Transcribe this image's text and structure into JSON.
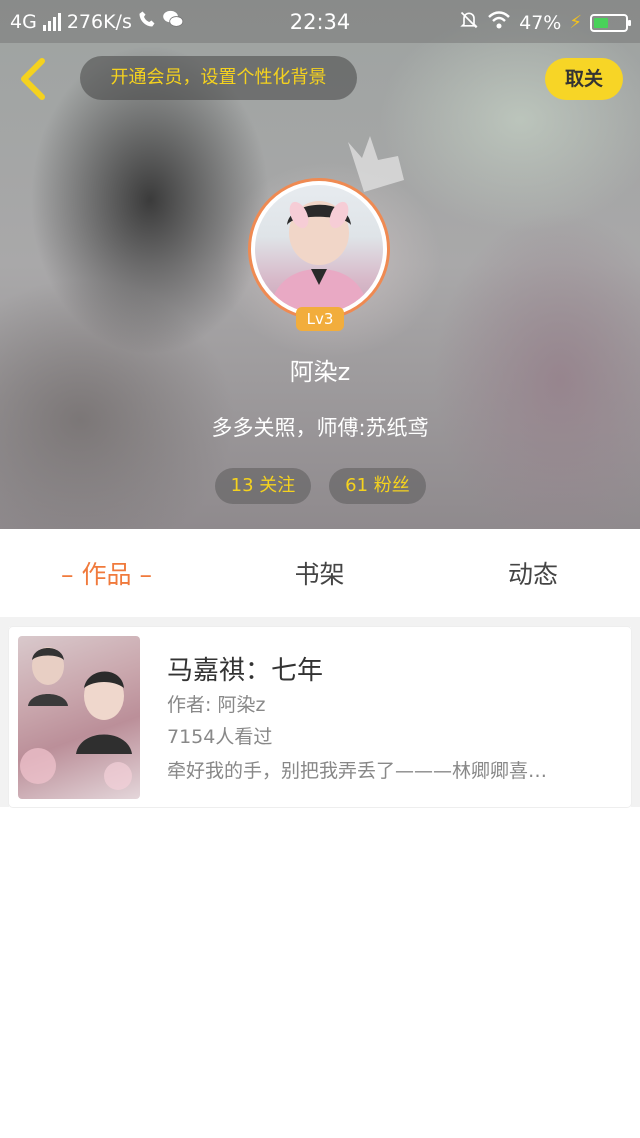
{
  "status_bar": {
    "network": "4G",
    "speed": "276K/s",
    "time": "22:34",
    "battery": "47%",
    "battery_level": 0.47,
    "icons": [
      "signal-icon",
      "phone-icon",
      "wechat-icon",
      "mute-bell-icon",
      "wifi-icon",
      "charging-bolt-icon",
      "battery-icon"
    ]
  },
  "header": {
    "back_icon": "chevron-left-icon",
    "vip_prompt": "开通会员，设置个性化背景",
    "cancel_label": "取关",
    "crown_icon": "crown-icon"
  },
  "profile": {
    "level": "Lv3",
    "username": "阿染z",
    "bio": "多多关照，师傅:苏纸鸢",
    "following": "13 关注",
    "fans": "61 粉丝"
  },
  "tabs": [
    {
      "label": "– 作品 –",
      "active": true
    },
    {
      "label": "书架",
      "active": false
    },
    {
      "label": "动态",
      "active": false
    }
  ],
  "works": [
    {
      "title": "马嘉祺：七年",
      "author": "作者: 阿染z",
      "views": "7154人看过",
      "description": "牵好我的手，别把我弄丢了———林卿卿喜…"
    }
  ],
  "colors": {
    "accent_orange": "#f07a3c",
    "vip_yellow": "#f5d21e",
    "cancel_bg": "#f7d526",
    "level_badge": "#f2ad3c",
    "battery_fill": "#49d15a"
  }
}
